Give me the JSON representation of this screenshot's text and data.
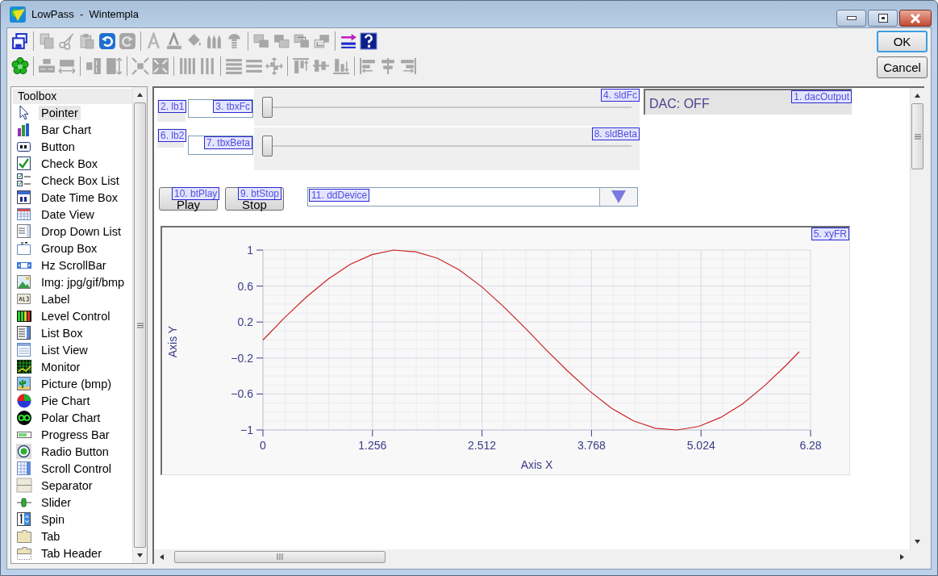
{
  "window": {
    "title": "LowPass  -  Wintempla"
  },
  "toolbar": {
    "rows": [
      {
        "groups": [
          {
            "items": [
              {
                "disabled": false
              }
            ]
          },
          {
            "items": [
              {
                "disabled": true
              },
              {
                "disabled": true
              },
              {
                "disabled": true
              },
              {
                "disabled": false
              },
              {
                "disabled": true
              }
            ]
          },
          {
            "items": [
              {
                "disabled": true
              },
              {
                "disabled": true
              },
              {
                "disabled": true
              },
              {
                "disabled": true
              },
              {
                "disabled": true
              }
            ]
          },
          {
            "items": [
              {
                "disabled": true
              },
              {
                "disabled": true
              },
              {
                "disabled": true
              },
              {
                "disabled": true
              }
            ]
          },
          {
            "items": [
              {
                "disabled": false
              },
              {
                "disabled": false
              }
            ]
          }
        ]
      },
      {
        "groups": [
          {
            "items": [
              {
                "disabled": false
              }
            ]
          },
          {
            "items": [
              {
                "disabled": true
              },
              {
                "disabled": true
              }
            ]
          },
          {
            "items": [
              {
                "disabled": true
              },
              {
                "disabled": true
              }
            ]
          },
          {
            "items": [
              {
                "disabled": true
              },
              {
                "disabled": true
              }
            ]
          },
          {
            "items": [
              {
                "disabled": true
              },
              {
                "disabled": true
              }
            ]
          },
          {
            "items": [
              {
                "disabled": true
              },
              {
                "disabled": true
              },
              {
                "disabled": true
              }
            ]
          },
          {
            "items": [
              {
                "disabled": true
              },
              {
                "disabled": true
              },
              {
                "disabled": true
              }
            ]
          },
          {
            "items": [
              {
                "disabled": true
              },
              {
                "disabled": true
              },
              {
                "disabled": true
              }
            ]
          }
        ]
      }
    ]
  },
  "dialog_buttons": [
    {
      "label": "OK",
      "default": true
    },
    {
      "label": "Cancel",
      "default": false
    }
  ],
  "toolbox": {
    "title": "Toolbox",
    "items": [
      {
        "label": "Pointer",
        "selected": true
      },
      {
        "label": "Bar Chart",
        "selected": false
      },
      {
        "label": "Button",
        "selected": false
      },
      {
        "label": "Check Box",
        "selected": false
      },
      {
        "label": "Check Box List",
        "selected": false
      },
      {
        "label": "Date Time Box",
        "selected": false
      },
      {
        "label": "Date View",
        "selected": false
      },
      {
        "label": "Drop Down List",
        "selected": false
      },
      {
        "label": "Group Box",
        "selected": false
      },
      {
        "label": "Hz ScrollBar",
        "selected": false
      },
      {
        "label": "Img: jpg/gif/bmp",
        "selected": false
      },
      {
        "label": "Label",
        "selected": false
      },
      {
        "label": "Level Control",
        "selected": false
      },
      {
        "label": "List Box",
        "selected": false
      },
      {
        "label": "List View",
        "selected": false
      },
      {
        "label": "Monitor",
        "selected": false
      },
      {
        "label": "Picture (bmp)",
        "selected": false
      },
      {
        "label": "Pie Chart",
        "selected": false
      },
      {
        "label": "Polar Chart",
        "selected": false
      },
      {
        "label": "Progress Bar",
        "selected": false
      },
      {
        "label": "Radio Button",
        "selected": false
      },
      {
        "label": "Scroll Control",
        "selected": false
      },
      {
        "label": "Separator",
        "selected": false
      },
      {
        "label": "Slider",
        "selected": false
      },
      {
        "label": "Spin",
        "selected": false
      },
      {
        "label": "Tab",
        "selected": false
      },
      {
        "label": "Tab Header",
        "selected": false
      }
    ]
  },
  "form": {
    "controls": [
      {
        "kind": "label",
        "tag": "2. lb1"
      },
      {
        "kind": "textbox",
        "tag": "3. tbxFc"
      },
      {
        "kind": "slider",
        "tag": "4. sldFc",
        "level": 0
      },
      {
        "kind": "output",
        "tag": "1. dacOutput",
        "text": "DAC: OFF"
      },
      {
        "kind": "label",
        "tag": "6. lb2"
      },
      {
        "kind": "textbox",
        "tag": "7. tbxBeta"
      },
      {
        "kind": "slider",
        "tag": "8. sldBeta",
        "level": 0
      },
      {
        "kind": "button",
        "tag": "10. btPlay",
        "label": "Play"
      },
      {
        "kind": "button",
        "tag": "9. btStop",
        "label": "Stop"
      },
      {
        "kind": "dropdown",
        "tag": "11. ddDevice"
      },
      {
        "kind": "chart",
        "tag": "5. xyFR",
        "chart_data": {
          "type": "line",
          "xlabel": "Axis X",
          "ylabel": "Axis Y",
          "x": [
            0,
            0.25,
            0.5,
            0.75,
            1,
            1.25,
            1.5,
            1.75,
            2,
            2.25,
            2.5,
            2.75,
            3,
            3.25,
            3.5,
            3.75,
            4,
            4.25,
            4.5,
            4.75,
            5,
            5.25,
            5.5,
            5.75,
            6,
            6.15
          ],
          "series": [
            {
              "color": "#cc2222",
              "values": [
                0,
                0.25,
                0.48,
                0.68,
                0.84,
                0.95,
                1,
                0.98,
                0.91,
                0.78,
                0.6,
                0.38,
                0.14,
                -0.11,
                -0.35,
                -0.57,
                -0.76,
                -0.9,
                -0.98,
                -1,
                -0.96,
                -0.86,
                -0.71,
                -0.51,
                -0.28,
                -0.13
              ]
            }
          ],
          "grid": true,
          "xlim": [
            0,
            6.28
          ],
          "ylim": [
            -1,
            1
          ],
          "xticks": [
            0,
            1.256,
            2.512,
            3.768,
            5.024,
            6.28
          ],
          "yticks": [
            {
              "value": -1,
              "label": "−1"
            },
            {
              "value": -0.6,
              "label": "−0.6"
            },
            {
              "value": -0.2,
              "label": "−0.2"
            },
            0.2,
            0.6,
            1
          ]
        }
      }
    ]
  }
}
